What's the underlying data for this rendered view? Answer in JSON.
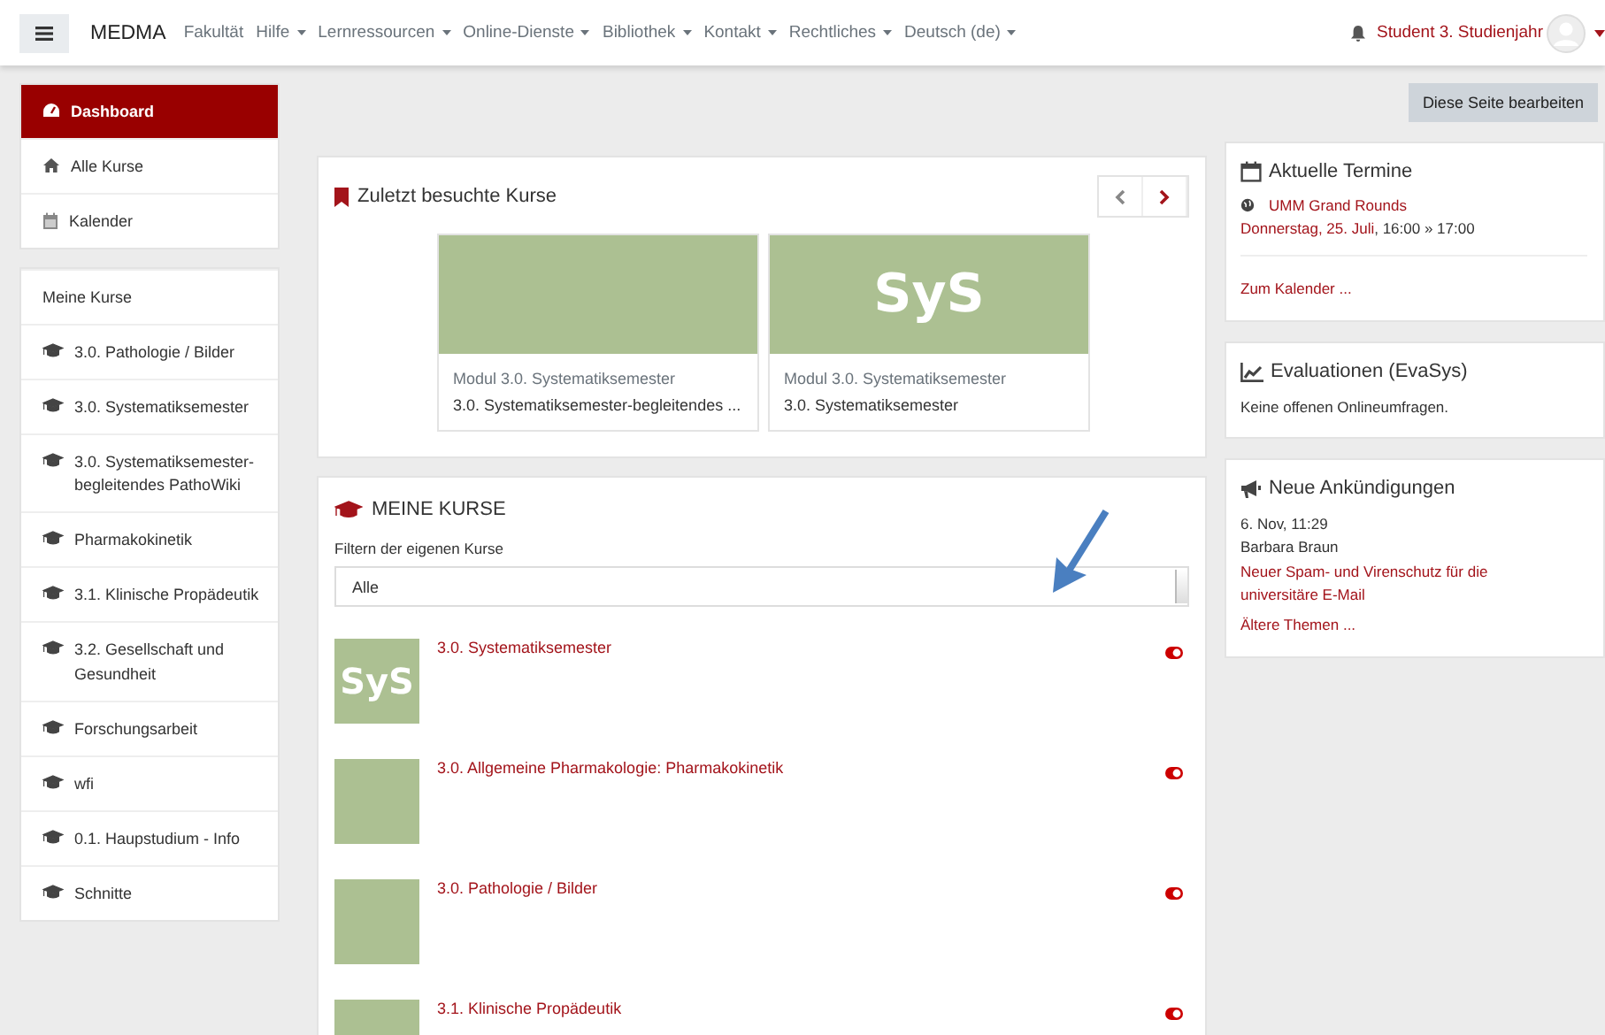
{
  "navbar": {
    "brand": "MEDMA",
    "items": [
      {
        "label": "Fakultät",
        "dropdown": false
      },
      {
        "label": "Hilfe",
        "dropdown": true
      },
      {
        "label": "Lernressourcen",
        "dropdown": true
      },
      {
        "label": "Online-Dienste",
        "dropdown": true
      },
      {
        "label": "Bibliothek",
        "dropdown": true
      },
      {
        "label": "Kontakt",
        "dropdown": true
      },
      {
        "label": "Rechtliches",
        "dropdown": true
      },
      {
        "label": "Deutsch (de)",
        "dropdown": true
      }
    ],
    "user": "Student 3. Studienjahr"
  },
  "sidebar": [
    [
      {
        "kind": "dashboard",
        "label": "Dashboard",
        "selected": true
      },
      {
        "kind": "home",
        "label": "Alle Kurse",
        "selected": false
      },
      {
        "kind": "calendar",
        "label": "Kalender",
        "selected": false
      }
    ],
    [
      {
        "kind": "header",
        "label": "Meine Kurse",
        "selected": false
      },
      {
        "kind": "course",
        "label": "3.0. Pathologie / Bilder",
        "selected": false
      },
      {
        "kind": "course",
        "label": "3.0. Systematiksemester",
        "selected": false
      },
      {
        "kind": "course",
        "label": "3.0. Systematiksemester-begleitendes PathoWiki",
        "selected": false
      },
      {
        "kind": "course",
        "label": "Pharmakokinetik",
        "selected": false
      },
      {
        "kind": "course",
        "label": "3.1. Klinische Propädeutik",
        "selected": false
      },
      {
        "kind": "course",
        "label": "3.2. Gesellschaft und Gesundheit",
        "selected": false
      },
      {
        "kind": "course",
        "label": "Forschungsarbeit",
        "selected": false
      },
      {
        "kind": "course",
        "label": "wfi",
        "selected": false
      },
      {
        "kind": "course",
        "label": "0.1. Haupstudium - Info",
        "selected": false
      },
      {
        "kind": "course",
        "label": "Schnitte",
        "selected": false
      }
    ]
  ],
  "edit_button": "Diese Seite bearbeiten",
  "recent": {
    "title": "Zuletzt besuchte Kurse",
    "prev": {
      "disabled": true
    },
    "next": {
      "disabled": false
    },
    "courses": [
      {
        "category": "Modul 3.0. Systematiksemester",
        "name": "3.0. Systematiksemester-begleitendes ..."
      },
      {
        "image_text": "SyS",
        "category": "Modul 3.0. Systematiksemester",
        "name": "3.0. Systematiksemester"
      }
    ]
  },
  "my_courses": {
    "title": "MEINE KURSE",
    "filter_label": "Filtern der eigenen Kurse",
    "filter_value": "Alle",
    "courses": [
      {
        "image_text": "SyS",
        "name": "3.0. Systematiksemester"
      },
      {
        "name": "3.0. Allgemeine Pharmakologie: Pharmakokinetik"
      },
      {
        "name": "3.0. Pathologie / Bilder"
      },
      {
        "name": "3.1. Klinische Propädeutik"
      }
    ]
  },
  "annotation": {
    "kind": "arrow"
  },
  "events": {
    "title": "Aktuelle Termine",
    "items": [
      {
        "title": "UMM Grand Rounds",
        "date": "Donnerstag, 25. Juli",
        "time": ", 16:00 » 17:00"
      }
    ],
    "footer_link": "Zum Kalender ..."
  },
  "evaluations": {
    "title": "Evaluationen (EvaSys)",
    "text": "Keine offenen Onlineumfragen."
  },
  "news": {
    "title": "Neue Ankündigungen",
    "items": [
      {
        "date": "6. Nov, 11:29",
        "author": "Barbara Braun",
        "title": "Neuer Spam- und Virenschutz für die universitäre E-Mail"
      }
    ],
    "more_link": "Ältere Themen ..."
  }
}
